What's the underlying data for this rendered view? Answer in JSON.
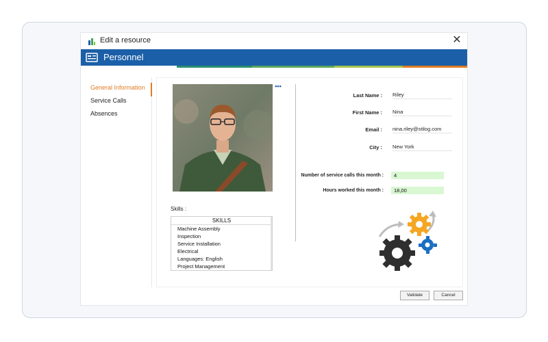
{
  "window": {
    "title": "Edit a resource"
  },
  "header": {
    "title": "Personnel",
    "strip_colors": [
      "#2a8f6f",
      "#5ba65c",
      "#a7c34b",
      "#e07c21"
    ]
  },
  "sidebar": {
    "items": [
      {
        "label": "General Information",
        "active": true
      },
      {
        "label": "Service Calls",
        "active": false
      },
      {
        "label": "Absences",
        "active": false
      }
    ]
  },
  "photo": {
    "more_label": "•••"
  },
  "fields": [
    {
      "label": "Last Name :",
      "value": "Riley"
    },
    {
      "label": "First Name :",
      "value": "Nina"
    },
    {
      "label": "Email :",
      "value": "nina.riley@stilog.com"
    },
    {
      "label": "City :",
      "value": "New York"
    }
  ],
  "stats": [
    {
      "label": "Number of service calls this month :",
      "value": "4"
    },
    {
      "label": "Hours worked this month :",
      "value": "18,00"
    }
  ],
  "skills": {
    "label": "Skills :",
    "header": "SKILLS",
    "items": [
      "Machine Assembly",
      "Inspection",
      "Service Installation",
      "Electrical",
      "Languages:  English",
      "Project Management"
    ]
  },
  "buttons": {
    "validate": "Validate",
    "cancel": "Cancel"
  },
  "colors": {
    "accent": "#1b5fa8",
    "active": "#e07c21",
    "stat_bg": "#d9f7d2",
    "gear_dark": "#2f2f2f",
    "gear_orange": "#f5a623",
    "gear_blue": "#1b6fc2"
  }
}
